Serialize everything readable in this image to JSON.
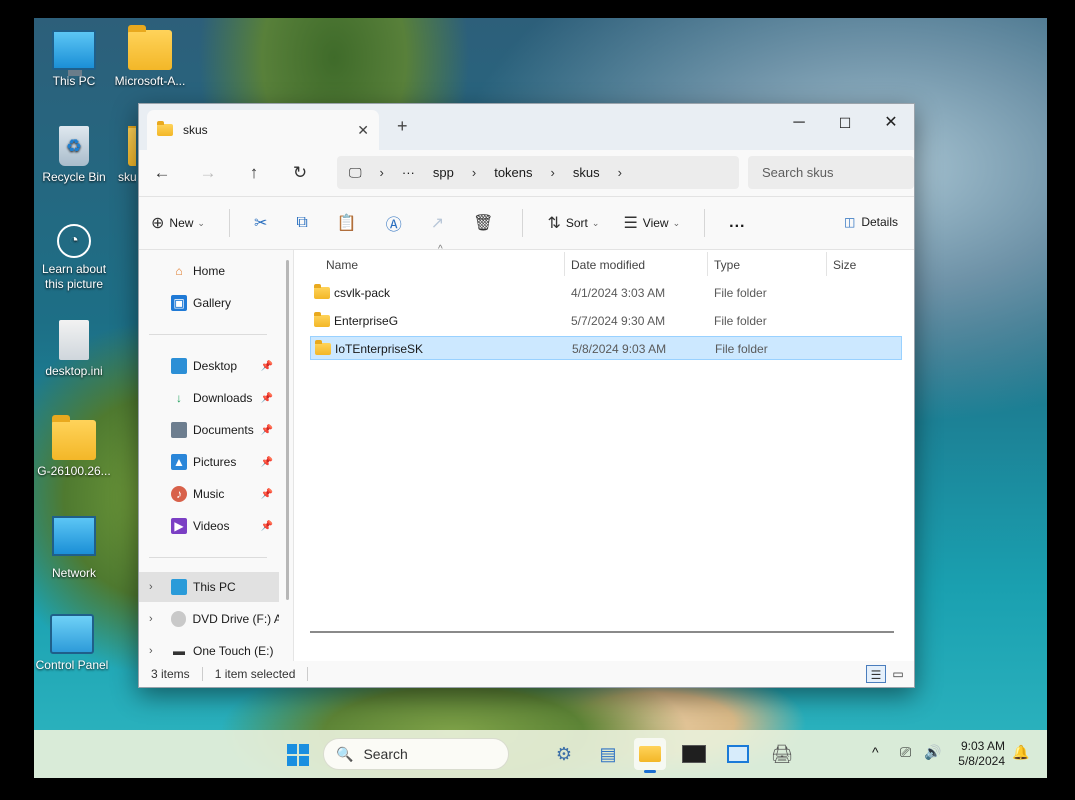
{
  "desktop": {
    "icons": [
      {
        "label": "This PC"
      },
      {
        "label": "Microsoft-A..."
      },
      {
        "label": "Recycle Bin"
      },
      {
        "label": "skus"
      },
      {
        "label": "Learn about this picture"
      },
      {
        "label": "desktop.ini"
      },
      {
        "label": "G-26100.26..."
      },
      {
        "label": "Network"
      },
      {
        "label": "Control Panel"
      }
    ]
  },
  "window": {
    "tab_title": "skus",
    "breadcrumb": [
      "spp",
      "tokens",
      "skus"
    ],
    "search_placeholder": "Search skus",
    "toolbar": {
      "new_label": "New",
      "sort_label": "Sort",
      "view_label": "View",
      "more_label": "...",
      "details_label": "Details"
    },
    "nav": {
      "home": "Home",
      "gallery": "Gallery",
      "desktop": "Desktop",
      "downloads": "Downloads",
      "documents": "Documents",
      "pictures": "Pictures",
      "music": "Music",
      "videos": "Videos",
      "this_pc": "This PC",
      "dvd": "DVD Drive (F:) A",
      "one_touch": "One Touch (E:)"
    },
    "columns": {
      "name": "Name",
      "date": "Date modified",
      "type": "Type",
      "size": "Size"
    },
    "files": [
      {
        "name": "csvlk-pack",
        "date": "4/1/2024 3:03 AM",
        "type": "File folder"
      },
      {
        "name": "EnterpriseG",
        "date": "5/7/2024 9:30 AM",
        "type": "File folder"
      },
      {
        "name": "IoTEnterpriseSK",
        "date": "5/8/2024 9:03 AM",
        "type": "File folder",
        "selected": true
      }
    ],
    "status": {
      "items": "3 items",
      "selected": "1 item selected"
    }
  },
  "taskbar": {
    "search_label": "Search",
    "time": "9:03 AM",
    "date": "5/8/2024"
  },
  "colors": {
    "accent": "#1a6fd1",
    "selection": "#cce8ff",
    "folder": "#f3b728"
  }
}
